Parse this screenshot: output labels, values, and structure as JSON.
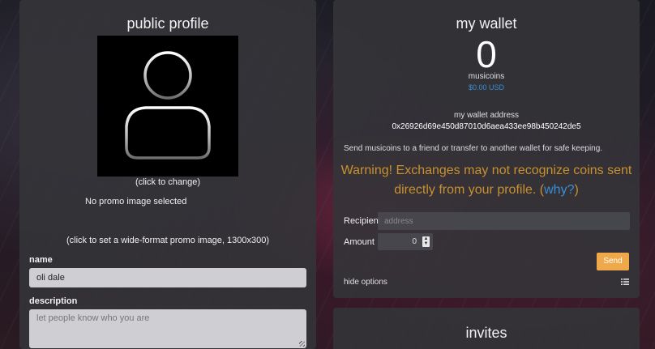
{
  "profile": {
    "title": "public profile",
    "click_to_change": "(click to change)",
    "no_promo": "No promo image selected",
    "promo_hint": "(click to set a wide-format promo image, 1300x300)",
    "name_label": "name",
    "name_value": "oli dale",
    "description_label": "description",
    "description_placeholder": "let people know who you are"
  },
  "wallet": {
    "title": "my wallet",
    "balance": "0",
    "balance_unit": "musicoins",
    "balance_usd": "$0.00 USD",
    "address_label": "my wallet address",
    "address_value": "0x26926d69e450d87010d6aea433ee98b450242de5",
    "send_info": "Send musicoins to a friend or transfer to another wallet for safe keeping.",
    "warning_text": "Warning! Exchanges may not recognize coins sent directly from your profile. (",
    "warning_link": "why?",
    "warning_close": ")",
    "recipient_label": "Recipient",
    "recipient_placeholder": "address",
    "amount_label": "Amount",
    "amount_value": "0",
    "send_label": "Send",
    "hide_options": "hide options",
    "options_icon": "list-icon"
  },
  "invites": {
    "title": "invites"
  },
  "colors": {
    "accent_orange": "#f0a94a",
    "warning_gold": "#c8912e",
    "link_blue": "#3a8fd9"
  },
  "icons": {
    "avatar": "user-silhouette-icon"
  }
}
